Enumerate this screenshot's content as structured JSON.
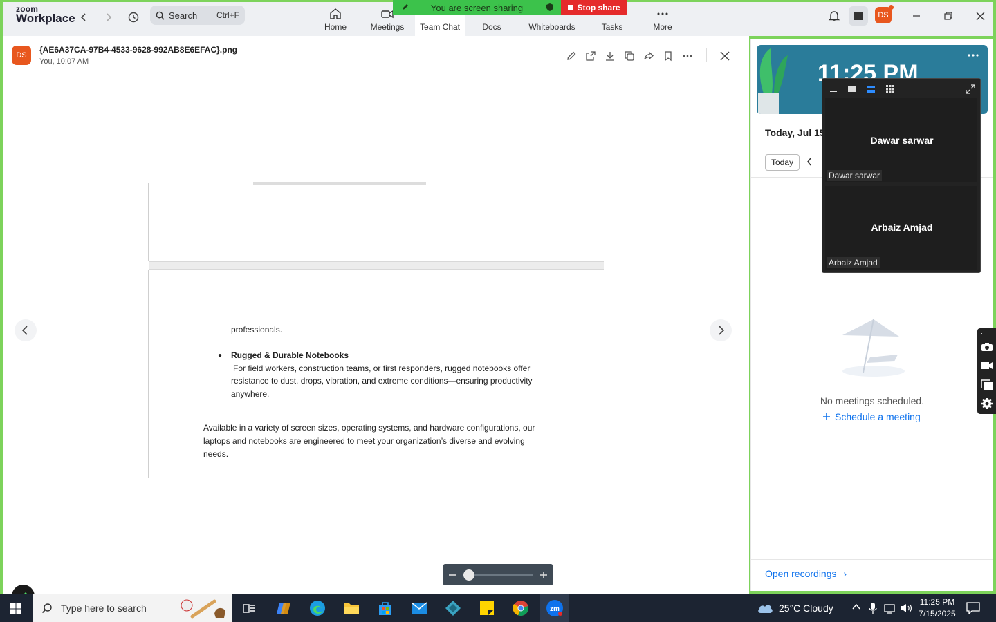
{
  "app": {
    "logo_small": "zoom",
    "logo_big": "Workplace"
  },
  "search": {
    "label": "Search",
    "shortcut": "Ctrl+F"
  },
  "nav_tabs": [
    {
      "label": "Home"
    },
    {
      "label": "Meetings"
    },
    {
      "label": "Team Chat"
    },
    {
      "label": "Docs"
    },
    {
      "label": "Whiteboards"
    },
    {
      "label": "Tasks"
    },
    {
      "label": "More"
    }
  ],
  "sharing": {
    "banner": "You are screen sharing",
    "stop": "Stop share"
  },
  "user": {
    "initials": "DS"
  },
  "file": {
    "name": "{AE6A37CA-97B4-4533-9628-992AB8E6EFAC}.png",
    "meta": "You, 10:07 AM"
  },
  "document": {
    "p1": "professionals.",
    "bullet_title": "Rugged & Durable Notebooks",
    "bullet_body_1": "For field workers, construction teams, or first responders, rugged notebooks offer",
    "bullet_body_2": "resistance to dust, drops, vibration, and extreme conditions—ensuring productivity",
    "bullet_body_3": "anywhere.",
    "closing_1": "Available in a variety of screen sizes, operating systems, and hardware configurations, our",
    "closing_2": "laptops and notebooks are engineered to meet your organization’s diverse and evolving",
    "closing_3": "needs."
  },
  "zoom": {
    "level": 0
  },
  "calendar": {
    "clock": "11:25 PM",
    "date": "Today, Jul 15",
    "today_btn": "Today",
    "empty": "No meetings scheduled.",
    "schedule": "Schedule a meeting",
    "open_recordings": "Open recordings"
  },
  "video": {
    "participants": [
      {
        "name": "Dawar sarwar",
        "label": "Dawar sarwar"
      },
      {
        "name": "Arbaiz Amjad",
        "label": "Arbaiz Amjad"
      }
    ]
  },
  "taskbar": {
    "search_placeholder": "Type here to search",
    "weather": "25°C  Cloudy",
    "time": "11:25 PM",
    "date": "7/15/2025"
  },
  "colors": {
    "accent": "#0e72ed",
    "share_green": "#3cc24b",
    "stop_red": "#e52b2b",
    "avatar": "#e8571e"
  }
}
